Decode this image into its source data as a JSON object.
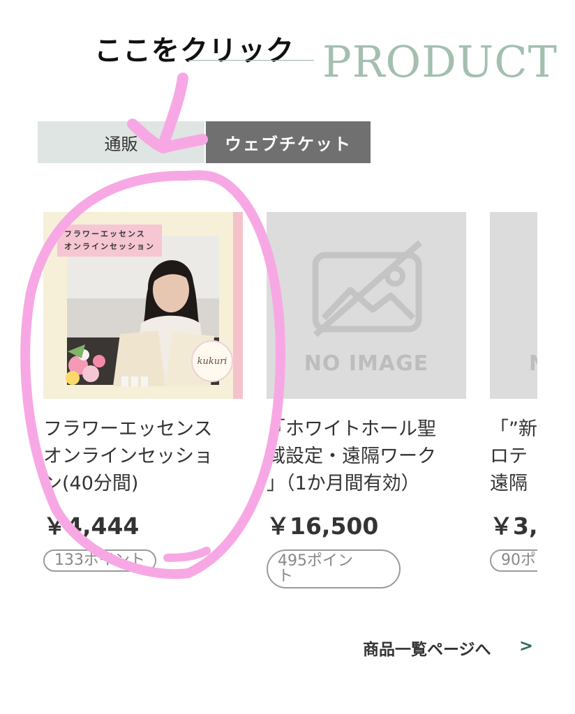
{
  "annotation": {
    "text": "ここをクリック"
  },
  "section": {
    "title": "PRODUCT"
  },
  "tabs": [
    {
      "label": "通販"
    },
    {
      "label": "ウェブチケット"
    }
  ],
  "products": [
    {
      "name": "フラワーエッセンス\nオンラインセッショ\nン(40分間)",
      "price": "￥4,444",
      "points": "133ポイント",
      "image": {
        "banner": "フラワーエッセンス\nオンラインセッション",
        "logo": "kukuri"
      }
    },
    {
      "name": "「ホワイトホール聖\n域設定・遠隔ワーク\n」（1か月間有効）",
      "price": "￥16,500",
      "points": "495ポイン\nト",
      "image": {
        "placeholder": "NO IMAGE"
      }
    },
    {
      "name": "「”新\nロテ\n遠隔",
      "price": "￥3,",
      "points": "90ポ",
      "image": {
        "placeholder": "N"
      }
    }
  ],
  "more_link": {
    "label": "商品一覧ページへ",
    "arrow": ">"
  },
  "colors": {
    "annotation_pink": "#f7a8e4",
    "tab_active": "#707070",
    "tab_inactive": "#dfe5e2",
    "title": "#a3bfb0"
  }
}
